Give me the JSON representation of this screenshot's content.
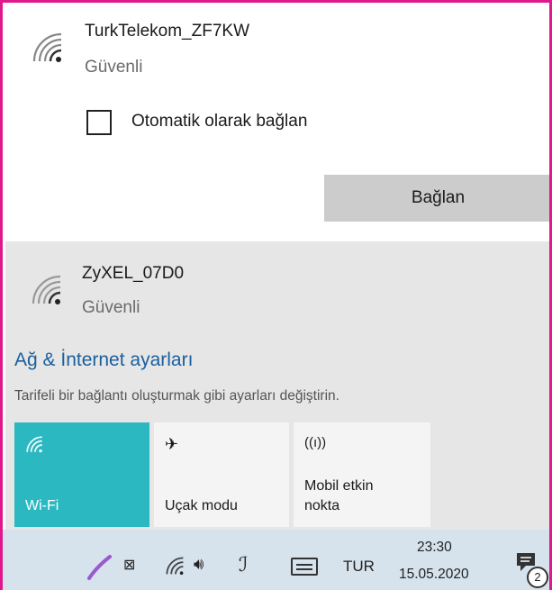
{
  "networks": [
    {
      "name": "TurkTelekom_ZF7KW",
      "status": "Güvenli"
    },
    {
      "name": "ZyXEL_07D0",
      "status": "Güvenli"
    }
  ],
  "connect_option": {
    "auto_connect_label": "Otomatik olarak bağlan",
    "checked": false
  },
  "connect_button_label": "Bağlan",
  "settings": {
    "link_label": "Ağ & İnternet ayarları",
    "description": "Tarifeli bir bağlantı oluşturmak gibi ayarları değiştirin."
  },
  "quick_actions": [
    {
      "label": "Wi-Fi",
      "icon": "wifi-icon",
      "active": true
    },
    {
      "label": "Uçak modu",
      "icon": "airplane-icon",
      "active": false
    },
    {
      "label_line1": "Mobil etkin",
      "label_line2": "nokta",
      "icon": "hotspot-icon",
      "active": false
    }
  ],
  "taskbar": {
    "language": "TUR",
    "time": "23:30",
    "date": "15.05.2020",
    "notification_count": "2",
    "icons": [
      "pen-icon",
      "network-disconnected-icon",
      "wifi-icon",
      "volume-icon",
      "stylus-icon",
      "keyboard-icon",
      "notification-icon"
    ]
  },
  "colors": {
    "accent": "#2bb8c0",
    "link": "#1a5f9e",
    "frame": "#e0188c"
  }
}
